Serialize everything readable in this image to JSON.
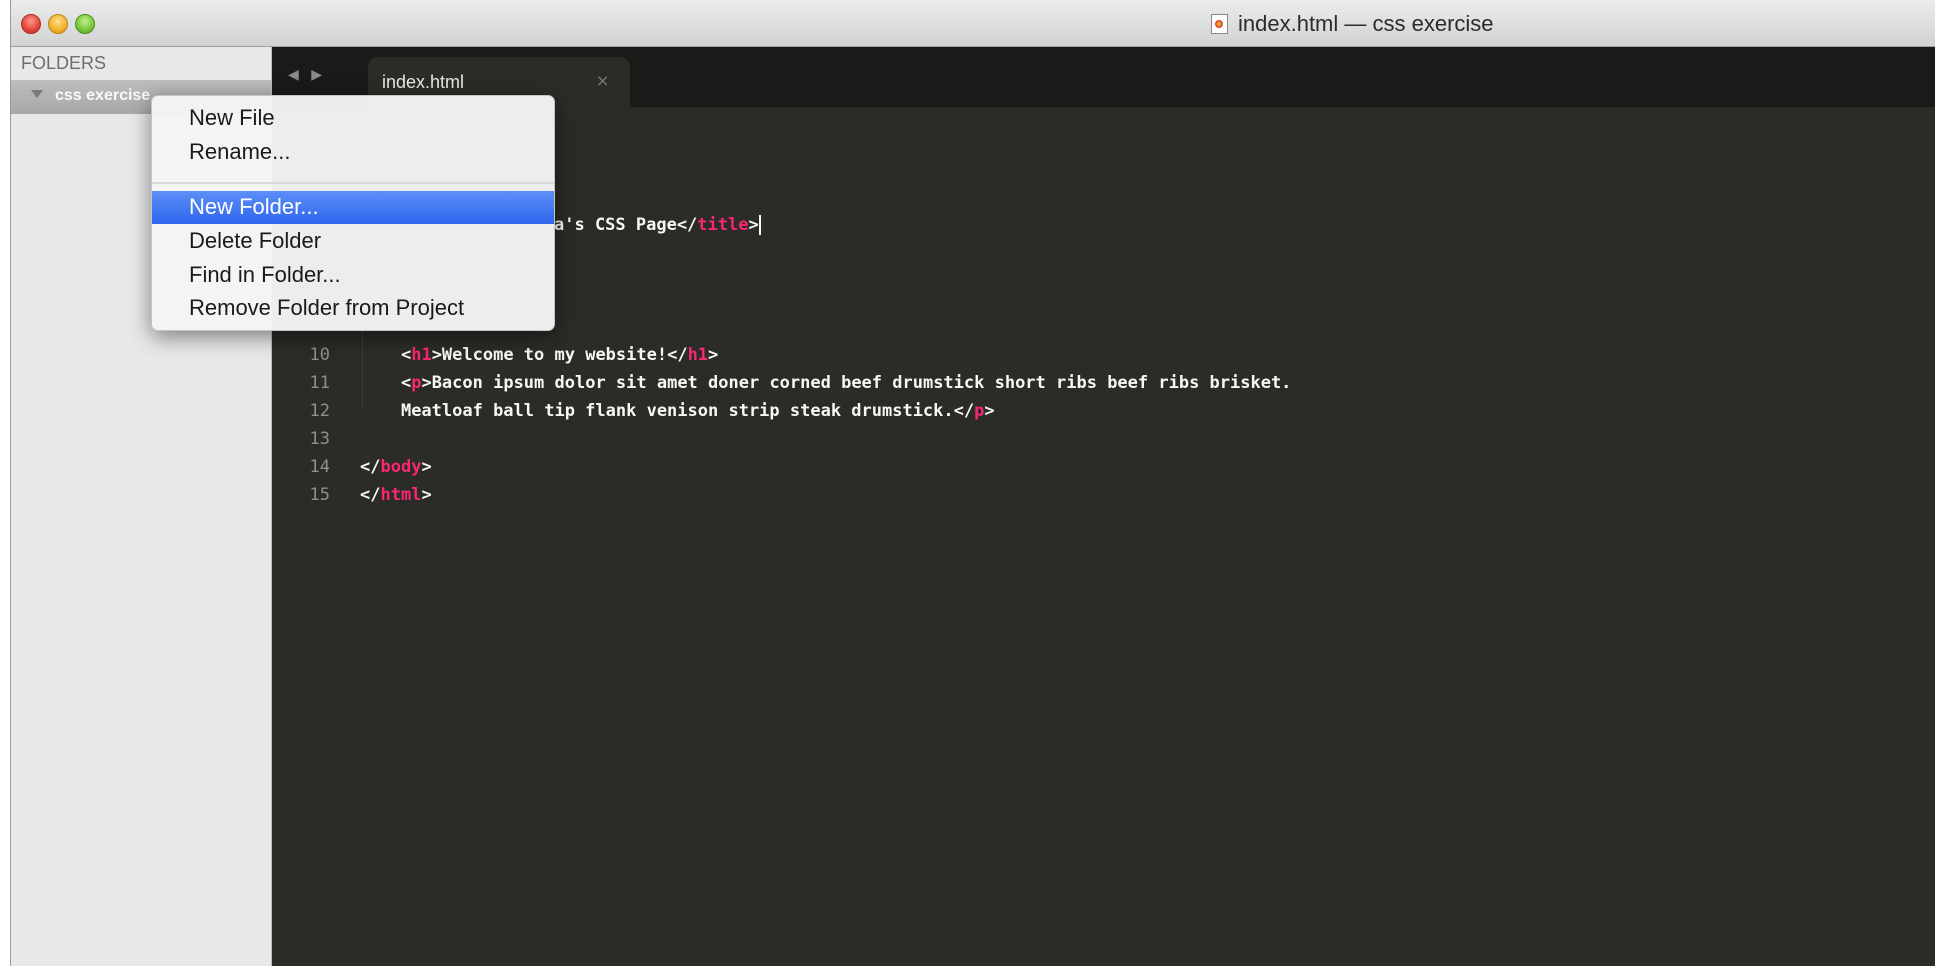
{
  "window": {
    "title": "index.html — css exercise",
    "title_icon": "html-document-icon"
  },
  "sidebar": {
    "header": "FOLDERS",
    "folders": [
      {
        "label": "css exercise",
        "expanded": true
      }
    ]
  },
  "tabbar": {
    "nav_label": "◀ ▶",
    "tabs": [
      {
        "label": "index.html",
        "close": "×",
        "active": true
      }
    ]
  },
  "editor": {
    "lines": [
      {
        "n": "10",
        "indent": "    ",
        "parts": [
          [
            "<",
            "p"
          ],
          [
            "h1",
            "t"
          ],
          [
            ">Welcome to my website!</",
            "p"
          ],
          [
            "h1",
            "t"
          ],
          [
            ">",
            "p"
          ]
        ]
      },
      {
        "n": "11",
        "indent": "    ",
        "parts": [
          [
            "<",
            "p"
          ],
          [
            "p",
            "t"
          ],
          [
            ">Bacon ipsum dolor sit amet doner corned beef drumstick short ribs beef ribs brisket.",
            "p"
          ]
        ]
      },
      {
        "n": "12",
        "indent": "    ",
        "parts": [
          [
            "Meatloaf ball tip flank venison strip steak drumstick.</",
            "p"
          ],
          [
            "p",
            "t"
          ],
          [
            ">",
            "p"
          ]
        ]
      },
      {
        "n": "13",
        "indent": "",
        "parts": []
      },
      {
        "n": "14",
        "indent": "",
        "parts": [
          [
            "</",
            "p"
          ],
          [
            "body",
            "t"
          ],
          [
            ">",
            "p"
          ]
        ]
      },
      {
        "n": "15",
        "indent": "",
        "parts": [
          [
            "</",
            "p"
          ],
          [
            "html",
            "t"
          ],
          [
            ">",
            "p"
          ]
        ]
      }
    ],
    "partial_line": {
      "n": "",
      "indent": "",
      "parts": [
        [
          "a's CSS Page</",
          "p"
        ],
        [
          "title",
          "t"
        ],
        [
          ">",
          "p"
        ]
      ]
    },
    "colors": {
      "tag": "#f92672",
      "text": "#f8f8f2",
      "line_number": "#8f908a",
      "background": "#2b2b27"
    }
  },
  "context_menu": {
    "items": [
      {
        "label": "New File",
        "highlighted": false
      },
      {
        "label": "Rename...",
        "highlighted": false
      },
      {
        "separator": true
      },
      {
        "label": "New Folder...",
        "highlighted": true
      },
      {
        "label": "Delete Folder",
        "highlighted": false
      },
      {
        "label": "Find in Folder...",
        "highlighted": false
      },
      {
        "label": "Remove Folder from Project",
        "highlighted": false
      }
    ]
  }
}
